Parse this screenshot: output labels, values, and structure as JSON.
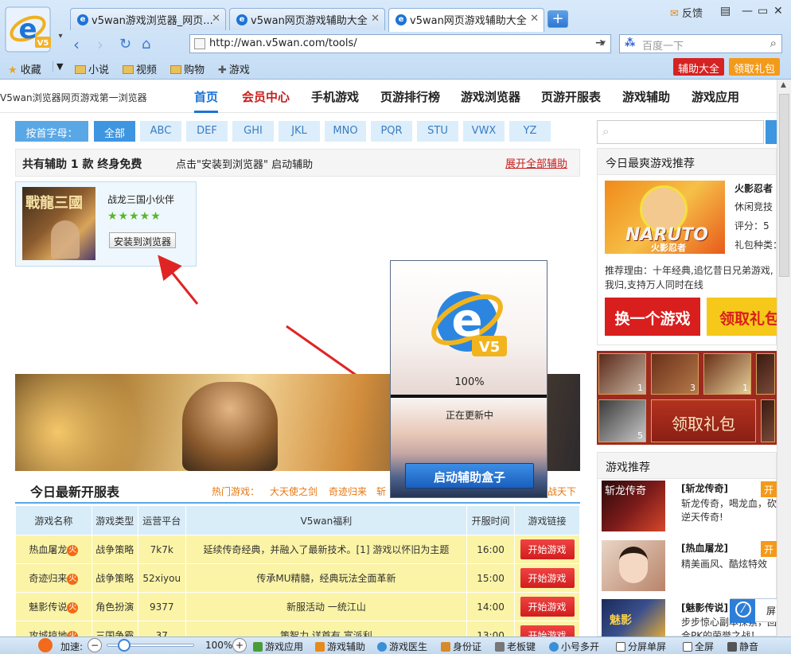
{
  "browser": {
    "logo_badge": "V5",
    "tabs": [
      {
        "title": "v5wan游戏浏览器_网页...",
        "active": false
      },
      {
        "title": "v5wan网页游戏辅助大全",
        "active": false
      },
      {
        "title": "v5wan网页游戏辅助大全",
        "active": true
      }
    ],
    "new_tab": "+",
    "feedback": "反馈",
    "url": "http://wan.v5wan.com/tools/",
    "search_placeholder": "百度一下",
    "favorites": "收藏",
    "bookmarks": [
      "小说",
      "视频",
      "购物",
      "游戏"
    ],
    "btn_assist": "辅助大全",
    "btn_gift": "领取礼包"
  },
  "site": {
    "slogan": "V5wan浏览器网页游戏第一浏览器",
    "nav": [
      "首页",
      "会员中心",
      "手机游戏",
      "页游排行榜",
      "游戏浏览器",
      "页游开服表",
      "游戏辅助",
      "游戏应用"
    ],
    "letters_label": "按首字母：",
    "letters": [
      "全部",
      "ABC",
      "DEF",
      "GHI",
      "JKL",
      "MNO",
      "PQR",
      "STU",
      "VWX",
      "YZ"
    ],
    "summary": "共有辅助 1 款 终身免费",
    "hint": "点击\"安装到浏览器\" 启动辅助",
    "expand_all": "展开全部辅助",
    "tool": {
      "name": "战龙三国小伙伴",
      "install": "安装到浏览器",
      "thumb_text": "戰龍三國"
    }
  },
  "server_list": {
    "title": "今日最新开服表",
    "hot_label": "热门游戏：",
    "hot_games": [
      "大天使之剑",
      "奇迹归来",
      "斩"
    ],
    "hot_tail": "战天下",
    "headers": [
      "游戏名称",
      "游戏类型",
      "运营平台",
      "V5wan福利",
      "开服时间",
      "游戏链接"
    ],
    "rows": [
      {
        "name": "热血屠龙",
        "type": "战争策略",
        "platform": "7k7k",
        "welfare": "延续传奇经典，并融入了最新技术。[1] 游戏以怀旧为主题",
        "time": "16:00",
        "link": "开始游戏"
      },
      {
        "name": "奇迹归来",
        "type": "战争策略",
        "platform": "52xiyou",
        "welfare": "传承MU精髓，经典玩法全面革新",
        "time": "15:00",
        "link": "开始游戏"
      },
      {
        "name": "魅影传说",
        "type": "角色扮演",
        "platform": "9377",
        "welfare": "新服活动 一统江山",
        "time": "14:00",
        "link": "开始游戏"
      },
      {
        "name": "攻城掠地",
        "type": "三国争霸",
        "platform": "37",
        "welfare": "策智力 详首有 富派利",
        "time": "13:00",
        "link": "开始游戏"
      }
    ],
    "hot_badge": "火"
  },
  "popup": {
    "badge": "V5",
    "progress": "100%",
    "progress_value": 1.0,
    "status": "正在更新中",
    "launch": "启动辅助盒子"
  },
  "right": {
    "today_title": "今日最爽游戏推荐",
    "game_name": "火影忍者",
    "game_type": "休闲竞技",
    "game_score": "评分：5",
    "game_gift": "礼包种类：",
    "game_img_text": "NARUTO",
    "game_img_sub": "火影忍者",
    "reason": "推荐理由：十年经典,追忆昔日兄弟游戏,我归,支持万人同时在线",
    "btn_switch": "换一个游戏",
    "btn_gift": "领取礼包",
    "items": [
      "1",
      "3",
      "1",
      "5"
    ],
    "gift_big": "领取礼包",
    "rec_title": "游戏推荐",
    "recs": [
      {
        "title": "[斩龙传奇]",
        "desc": "斩龙传奇，喝龙血，砍逆天传奇!",
        "img_text": "斩龙传奇",
        "color": "#7a1a1a"
      },
      {
        "title": "[热血屠龙]",
        "desc": "精美画风、酷炫特效",
        "img_text": "",
        "color": "#d8b5a0"
      },
      {
        "title": "[魅影传说]",
        "desc": "步步惊心副本探索，回合PK的荣誉之战！",
        "img_text": "魅影",
        "color": "#3a4f8c"
      }
    ],
    "rec_tag": "开",
    "screen_tip": "屏蔽"
  },
  "statusbar": {
    "speed": "加速:",
    "zoom": "100%",
    "zoom_value": 0.12,
    "items": [
      "游戏应用",
      "游戏辅助",
      "游戏医生",
      "身份证",
      "老板键",
      "小号多开",
      "分屏单屏",
      "全屏",
      "静音"
    ]
  },
  "colors": {
    "accent": "#1d74d6",
    "red": "#d81e1e",
    "orange": "#f08a0c",
    "nav_active": "#1d74d6",
    "member": "#c81e1e"
  }
}
